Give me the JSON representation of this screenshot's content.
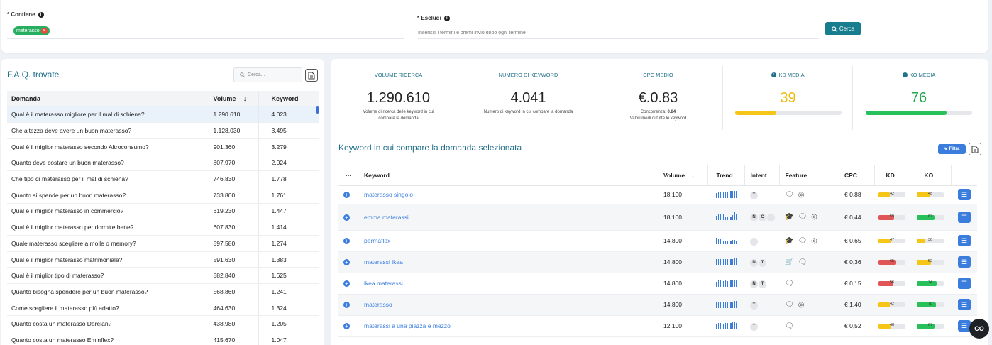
{
  "filters": {
    "contiene_label": "* Contiene",
    "contiene_tag": "materasso",
    "escludi_label": "* Escludi",
    "escludi_placeholder": "Inserisci i termini e premi invio dopo ogni termine",
    "search_button": "Cerca"
  },
  "faq": {
    "title": "F.A.Q. trovate",
    "search_placeholder": "Cerca...",
    "headers": {
      "domanda": "Domanda",
      "volume": "Volume",
      "keyword": "Keyword",
      "sort_arrow": "↓"
    },
    "rows": [
      {
        "q": "Qual è il materasso migliore per il mal di schiena?",
        "vol": "1.290.610",
        "kw": "4.023"
      },
      {
        "q": "Che altezza deve avere un buon materasso?",
        "vol": "1.128.030",
        "kw": "3.495"
      },
      {
        "q": "Qual è il miglior materasso secondo Altroconsumo?",
        "vol": "901.360",
        "kw": "3.279"
      },
      {
        "q": "Quanto deve costare un buon materasso?",
        "vol": "807.970",
        "kw": "2.024"
      },
      {
        "q": "Che tipo di materasso per il mal di schiena?",
        "vol": "746.830",
        "kw": "1.778"
      },
      {
        "q": "Quanto si spende per un buon materasso?",
        "vol": "733.800",
        "kw": "1.761"
      },
      {
        "q": "Qual è il miglior materasso in commercio?",
        "vol": "619.230",
        "kw": "1.447"
      },
      {
        "q": "Qual è il miglior materasso per dormire bene?",
        "vol": "607.830",
        "kw": "1.414"
      },
      {
        "q": "Quale materasso scegliere a molle o memory?",
        "vol": "597.580",
        "kw": "1.274"
      },
      {
        "q": "Qual è il miglior materasso matrimoniale?",
        "vol": "591.630",
        "kw": "1.383"
      },
      {
        "q": "Qual è il miglior tipo di materasso?",
        "vol": "582.840",
        "kw": "1.625"
      },
      {
        "q": "Quanto bisogna spendere per un buon materasso?",
        "vol": "568.860",
        "kw": "1.241"
      },
      {
        "q": "Come scegliere il materasso più adatto?",
        "vol": "464.630",
        "kw": "1.324"
      },
      {
        "q": "Quanto costa un materasso Dorelan?",
        "vol": "438.980",
        "kw": "1.205"
      },
      {
        "q": "Quanto costa un materasso Eminflex?",
        "vol": "415.670",
        "kw": "1.047"
      }
    ]
  },
  "stats": {
    "volume": {
      "head": "VOLUME RICERCA",
      "value": "1.290.610",
      "sub": "Volume di ricerca delle keyword in cui compare la domanda"
    },
    "keywords": {
      "head": "NUMERO DI KEYWORD",
      "value": "4.041",
      "sub": "Numero di keyword in cui compare la domanda"
    },
    "cpc": {
      "head": "CPC MEDIO",
      "value": "€.0.83",
      "sub1": "Concorrenza:",
      "sub1_val": "0.84",
      "sub2": "Valori medi di tutte le keyword"
    },
    "kd": {
      "head": "KD MEDIA",
      "value": "39",
      "fill": 0.39,
      "color": "#f5c518"
    },
    "ko": {
      "head": "KO MEDIA",
      "value": "76",
      "fill": 0.76,
      "color": "#27c05a"
    }
  },
  "keywords_section": {
    "title": "Keyword in cui compare la domanda selezionata",
    "filter_button": "Filtra",
    "headers": {
      "dots": "···",
      "keyword": "Keyword",
      "volume": "Volume",
      "sort_arrow": "↓",
      "trend": "Trend",
      "intent": "Intent",
      "feature": "Feature",
      "cpc": "CPC",
      "kd": "KD",
      "ko": "KO"
    },
    "rows": [
      {
        "kw": "materasso singolo",
        "vol": "18.100",
        "intent": [
          "T"
        ],
        "features": [
          "chat",
          "pin"
        ],
        "cpc": "€ 0,88",
        "kd": 42,
        "ko": 48
      },
      {
        "kw": "emma materassi",
        "vol": "18.100",
        "intent": [
          "N",
          "C",
          "I"
        ],
        "features": [
          "grad",
          "chat",
          "pin"
        ],
        "cpc": "€ 0,44",
        "kd": 59,
        "ko": 67
      },
      {
        "kw": "permaflex",
        "vol": "14.800",
        "intent": [
          "I"
        ],
        "features": [
          "grad",
          "chat",
          "pin"
        ],
        "cpc": "€ 0,65",
        "kd": 47,
        "ko": 30
      },
      {
        "kw": "materassi ikea",
        "vol": "14.800",
        "intent": [
          "N",
          "T"
        ],
        "features": [
          "cart",
          "chat"
        ],
        "cpc": "€ 0,36",
        "kd": 65,
        "ko": 52
      },
      {
        "kw": "ikea materassi",
        "vol": "14.800",
        "intent": [
          "N",
          "T"
        ],
        "features": [
          "chat"
        ],
        "cpc": "€ 0,15",
        "kd": 56,
        "ko": 74
      },
      {
        "kw": "materasso",
        "vol": "14.800",
        "intent": [
          "T"
        ],
        "features": [
          "chat",
          "pin"
        ],
        "cpc": "€ 1,40",
        "kd": 42,
        "ko": 70
      },
      {
        "kw": "materassi a una piazza e mezzo",
        "vol": "12.100",
        "intent": [
          "T"
        ],
        "features": [
          "chat"
        ],
        "cpc": "€ 0,52",
        "kd": 48,
        "ko": 67
      }
    ]
  },
  "chat_button": "CO"
}
